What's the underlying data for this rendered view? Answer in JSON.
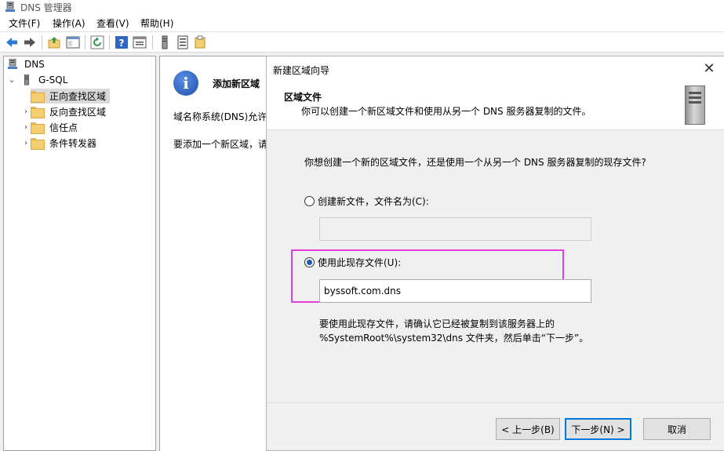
{
  "window": {
    "title": "DNS 管理器",
    "app_icon": "dns-server-icon"
  },
  "menu": [
    "文件(F)",
    "操作(A)",
    "查看(V)",
    "帮助(H)"
  ],
  "toolbar": {
    "icons": [
      "back-arrow-icon",
      "forward-arrow-icon",
      "up-folder-icon",
      "show-hide-tree-icon",
      "refresh-icon",
      "help-icon",
      "properties-icon",
      "server-icon",
      "list-icon",
      "filter-icon"
    ]
  },
  "tree": {
    "root": "DNS",
    "server": "G-SQL",
    "items": [
      {
        "label": "正向查找区域",
        "selected": true
      },
      {
        "label": "反向查找区域",
        "selected": false
      },
      {
        "label": "信任点",
        "selected": false
      },
      {
        "label": "条件转发器",
        "selected": false
      }
    ]
  },
  "content": {
    "title": "添加新区域",
    "line1": "域名称系统(DNS)允许",
    "line2": "要添加一个新区域，请"
  },
  "dialog": {
    "title": "新建区域向导",
    "close": "✕",
    "header_title": "区域文件",
    "header_subtitle": "你可以创建一个新区域文件和使用从另一个 DNS 服务器复制的文件。",
    "question": "你想创建一个新的区域文件，还是使用一个从另一个 DNS 服务器复制的现存文件?",
    "option_new": "创建新文件，文件名为(C):",
    "option_new_value": "",
    "option_existing": "使用此现存文件(U):",
    "option_existing_value": "byssoft.com.dns",
    "selected_option": "existing",
    "note_line1": "要使用此现存文件，请确认它已经被复制到该服务器上的",
    "note_line2": "%SystemRoot%\\system32\\dns 文件夹，然后单击“下一步”。",
    "buttons": {
      "back": "< 上一步(B)",
      "next": "下一步(N) >",
      "cancel": "取消"
    }
  }
}
